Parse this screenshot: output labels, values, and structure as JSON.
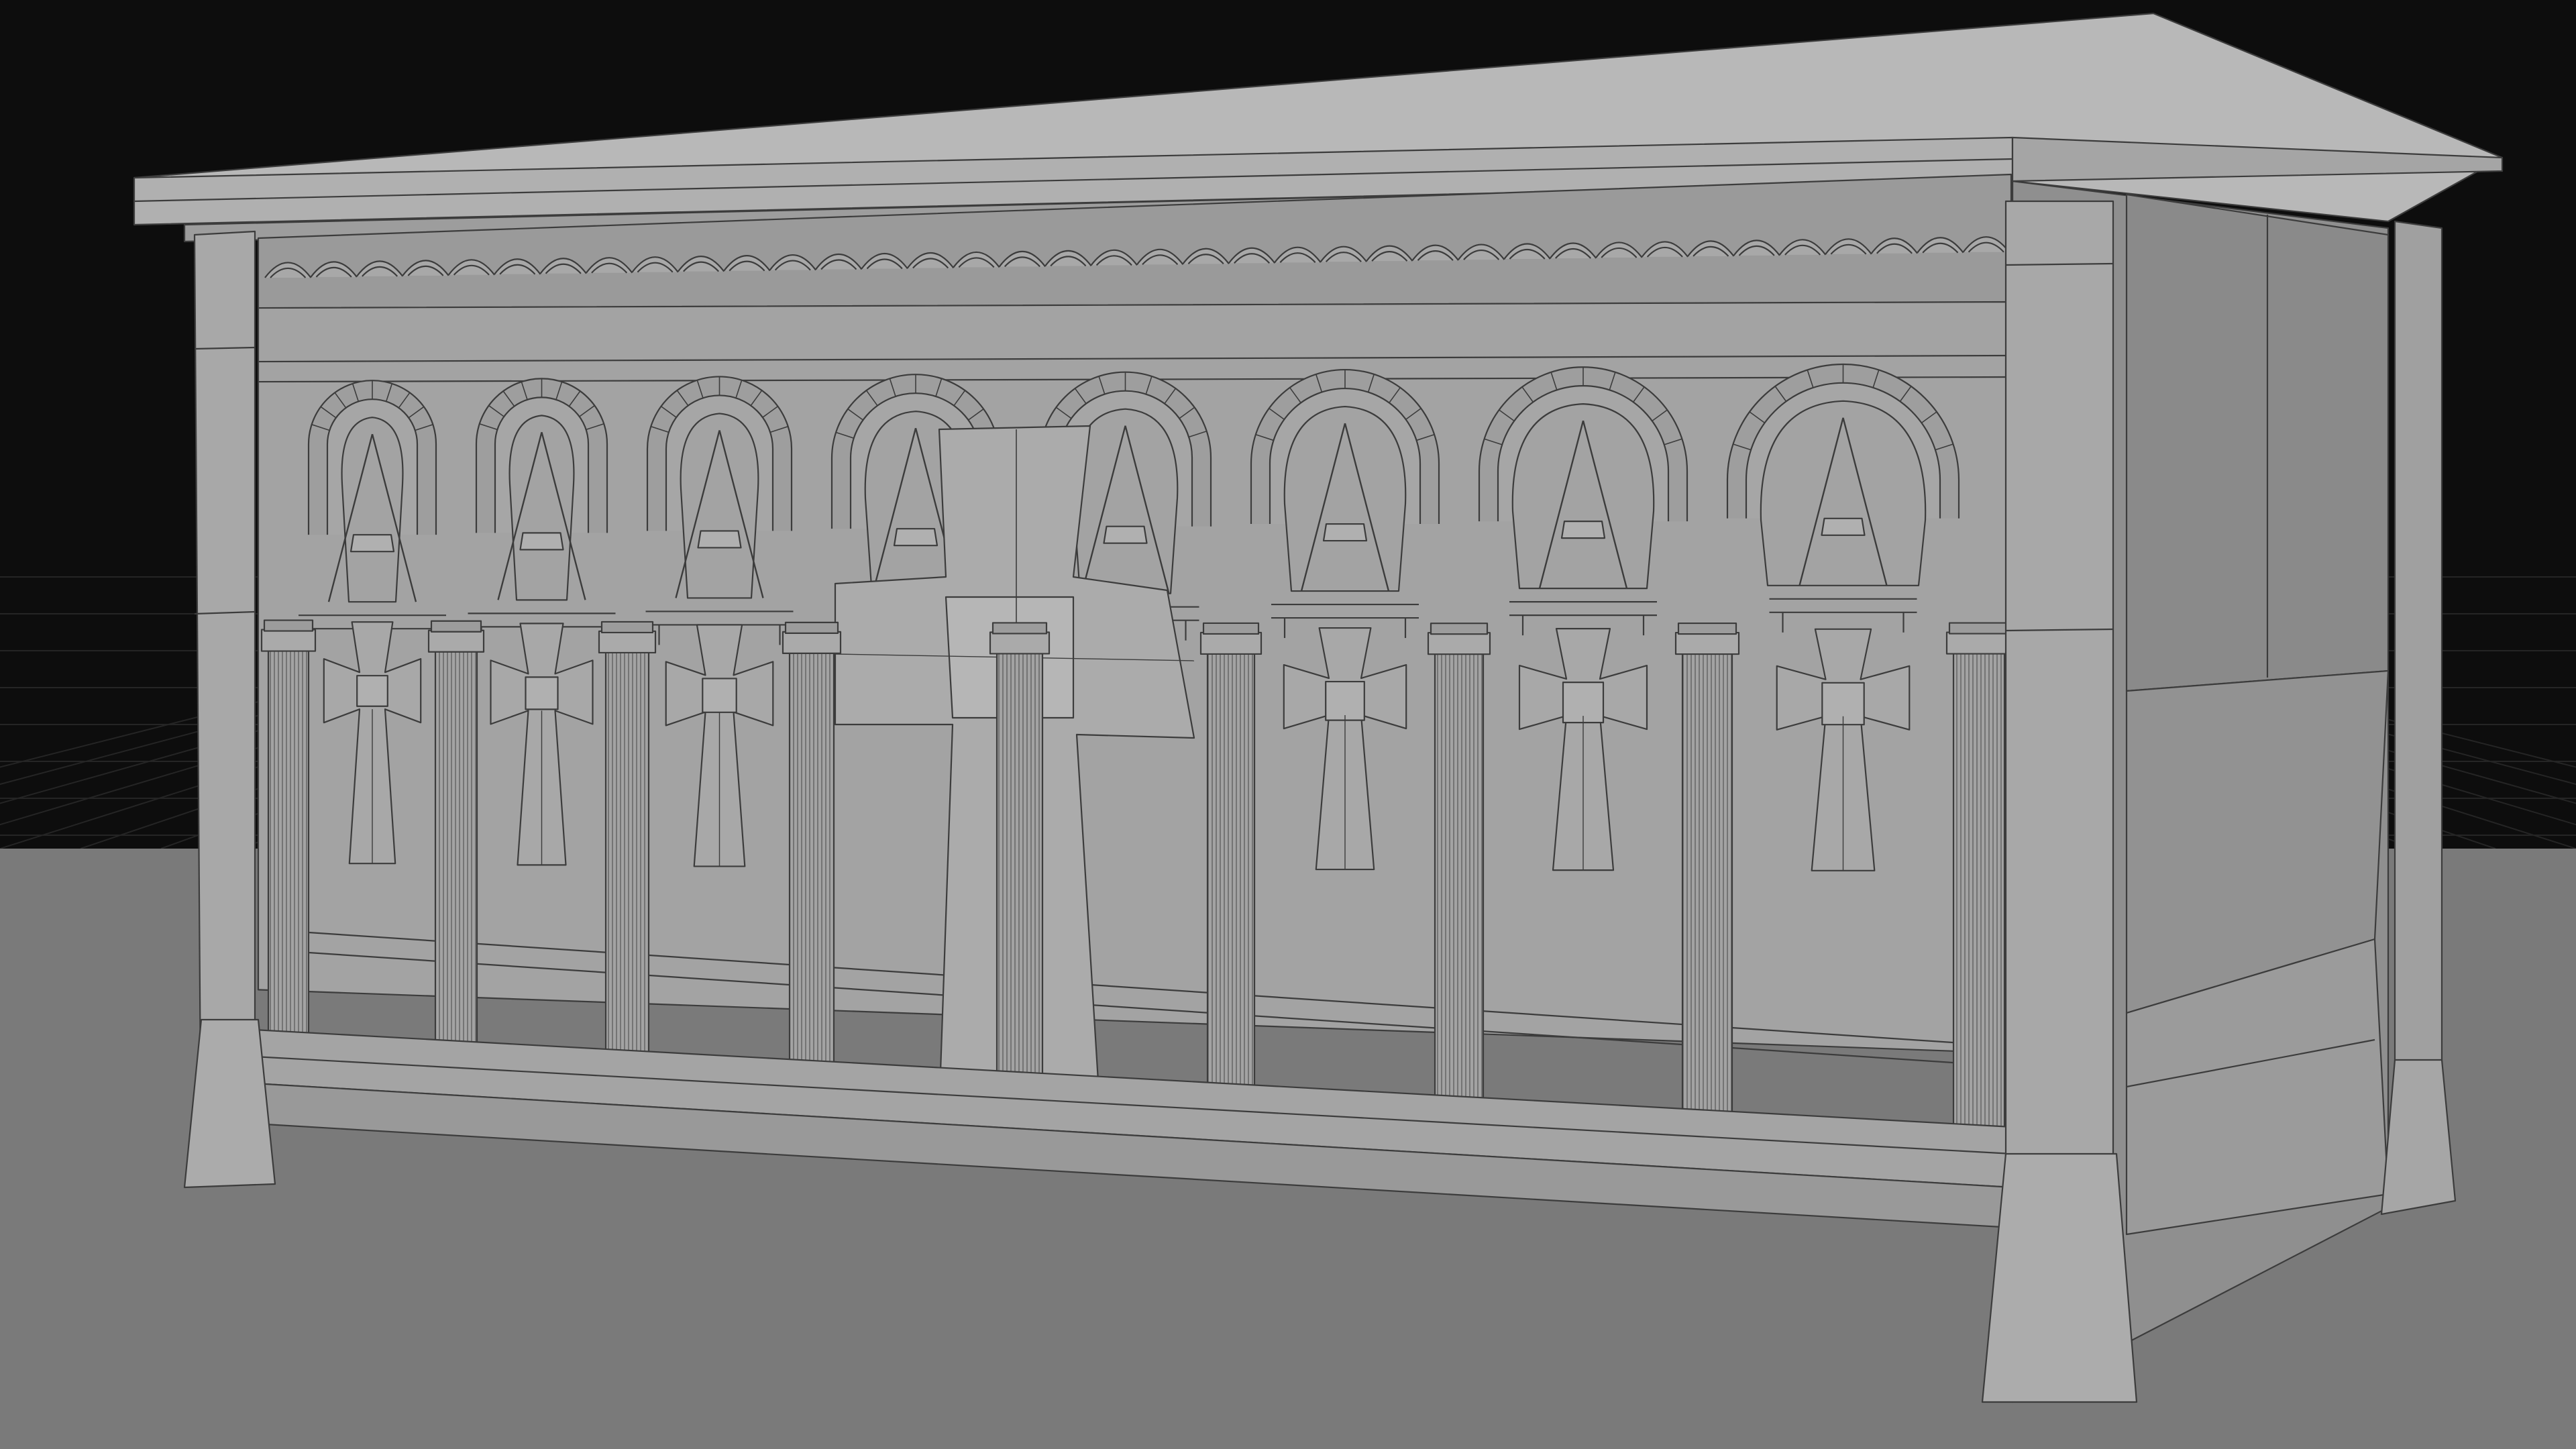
{
  "viewport": {
    "mode": "wireframe-on-shaded",
    "background_color": "#0d0d0d",
    "ground_color": "#7a7a7a",
    "grid_color": "#2a2a2a",
    "model_color": "#a3a3a3",
    "model_shadow_color": "#8a8a8a",
    "model_highlight_color": "#b8b8b8",
    "wire_color": "#3c3c3c",
    "horizon_accent_color": "#8a3d1f"
  },
  "model": {
    "object": "altar-tomb",
    "front_bays": 8,
    "columns": 9,
    "cross_count": 7,
    "arch_count": 8,
    "central_cross": true,
    "frieze": "scalloped-arcade"
  }
}
